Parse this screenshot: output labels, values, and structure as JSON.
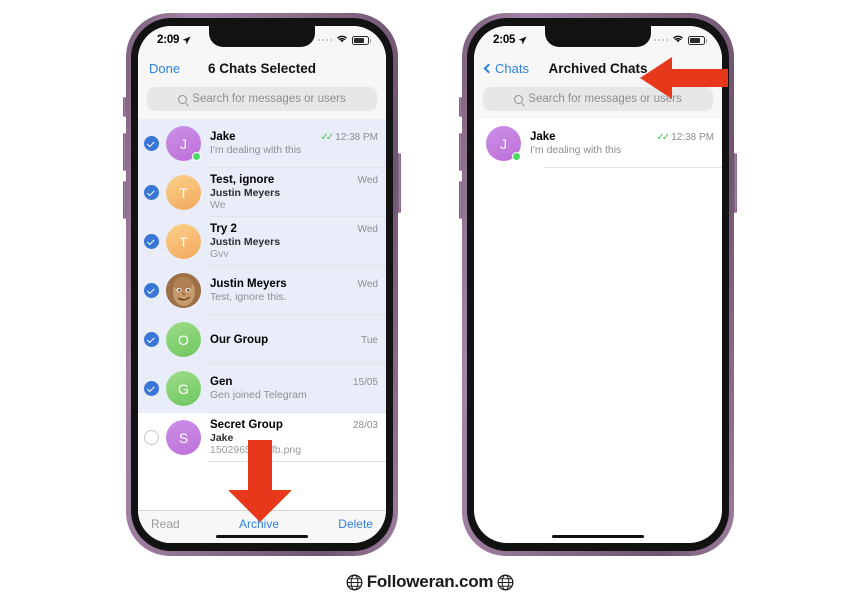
{
  "footer": {
    "brand": "Followeran.com",
    "globe_icon": "globe-icon"
  },
  "phone_left": {
    "status": {
      "time": "2:09",
      "location_icon": "location-arrow-icon",
      "wifi_icon": "wifi-icon",
      "battery_icon": "battery-icon",
      "signal_icon": "signal-dots-icon"
    },
    "nav": {
      "left_label": "Done",
      "title": "6 Chats Selected"
    },
    "search": {
      "placeholder": "Search for messages or users",
      "icon": "search-icon"
    },
    "rows": [
      {
        "selected": true,
        "avatar_kind": "purple",
        "initial": "J",
        "online": true,
        "title": "Jake",
        "author": "",
        "preview": "I'm dealing with this",
        "time": "12:38 PM",
        "read_ticks": true
      },
      {
        "selected": true,
        "avatar_kind": "orange",
        "initial": "T",
        "online": false,
        "title": "Test, ignore",
        "author": "Justin Meyers",
        "preview": "We",
        "time": "Wed",
        "read_ticks": false
      },
      {
        "selected": true,
        "avatar_kind": "orange",
        "initial": "T",
        "online": false,
        "title": "Try 2",
        "author": "Justin Meyers",
        "preview": "Gvv",
        "time": "Wed",
        "read_ticks": false
      },
      {
        "selected": true,
        "avatar_kind": "photo",
        "initial": "",
        "online": false,
        "title": "Justin Meyers",
        "author": "",
        "preview": "Test, ignore this.",
        "time": "Wed",
        "read_ticks": false
      },
      {
        "selected": true,
        "avatar_kind": "green",
        "initial": "O",
        "online": false,
        "title": "Our Group",
        "author": "",
        "preview": "",
        "time": "Tue",
        "read_ticks": false
      },
      {
        "selected": true,
        "avatar_kind": "green",
        "initial": "G",
        "online": false,
        "title": "Gen",
        "author": "",
        "preview": "Gen joined Telegram",
        "time": "15/05",
        "read_ticks": false
      },
      {
        "selected": false,
        "avatar_kind": "purple",
        "initial": "S",
        "online": false,
        "title": "Secret Group",
        "author": "Jake",
        "preview": "1502965175-fb.png",
        "time": "28/03",
        "read_ticks": false
      }
    ],
    "toolbar": {
      "read_label": "Read",
      "archive_label": "Archive",
      "delete_label": "Delete"
    },
    "annotation": {
      "arrow_icon": "red-down-arrow",
      "points_to": "Archive"
    }
  },
  "phone_right": {
    "status": {
      "time": "2:05",
      "location_icon": "location-arrow-icon",
      "wifi_icon": "wifi-icon",
      "battery_icon": "battery-icon",
      "signal_icon": "signal-dots-icon"
    },
    "nav": {
      "back_label": "Chats",
      "title": "Archived Chats",
      "back_icon": "chevron-left-icon"
    },
    "search": {
      "placeholder": "Search for messages or users",
      "icon": "search-icon"
    },
    "rows": [
      {
        "selected": false,
        "avatar_kind": "purple",
        "initial": "J",
        "online": true,
        "title": "Jake",
        "author": "",
        "preview": "I'm dealing with this",
        "time": "12:38 PM",
        "read_ticks": true
      }
    ],
    "annotation": {
      "arrow_icon": "red-left-arrow",
      "points_to": "Archived Chats"
    }
  },
  "colors": {
    "accent_blue": "#2f82e0",
    "selection_blue": "#3a76d8",
    "selected_row_bg": "#e9edf9",
    "arrow_red": "#e8381c",
    "online_green": "#4cd964",
    "tick_green": "#4cc257",
    "frame_purple": "#8d6f8e"
  }
}
